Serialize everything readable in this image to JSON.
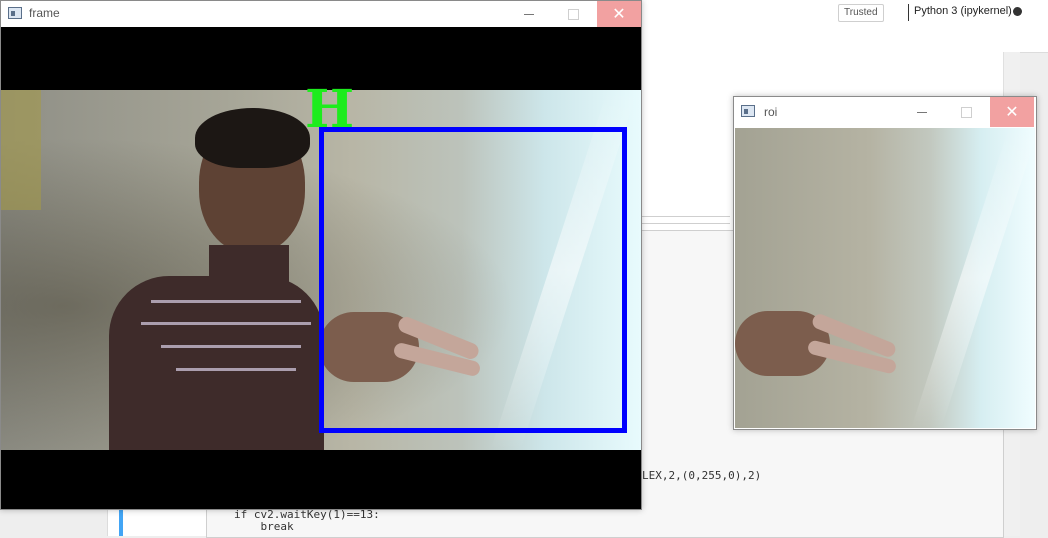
{
  "notebook": {
    "trusted_label": "Trusted",
    "kernel_label": "Python 3 (ipykernel)",
    "code_fragment": "LEX,2,(0,255,0),2)",
    "code_line_1": "if cv2.waitKey(1)==13:",
    "code_line_2": "    break"
  },
  "windows": {
    "frame": {
      "title": "frame",
      "overlay_letter": "H",
      "colors": {
        "roi_box": "#0000ff",
        "letter": "#1dec1d"
      }
    },
    "roi": {
      "title": "roi"
    }
  },
  "icons": [
    "window-app-icon",
    "minimize-icon",
    "maximize-icon",
    "close-icon",
    "kernel-status-icon"
  ]
}
